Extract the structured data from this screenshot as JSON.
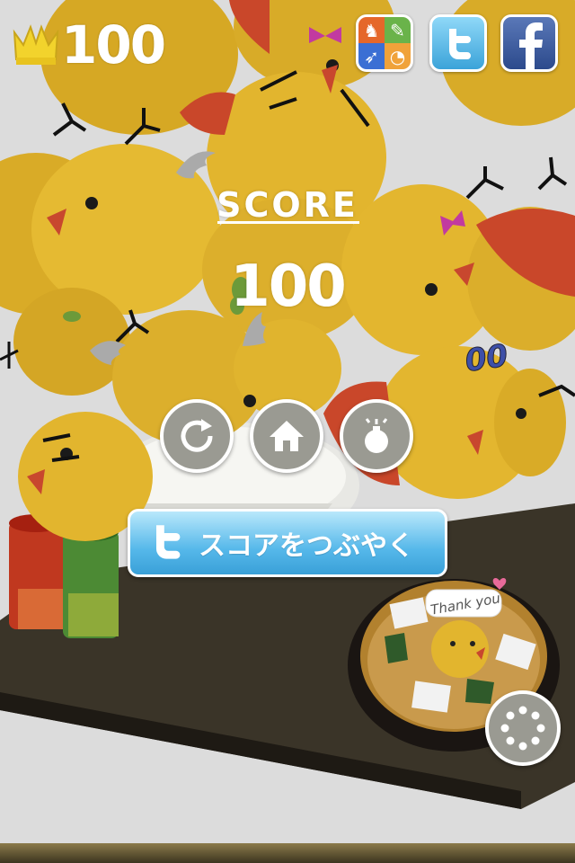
{
  "best_score": "100",
  "score": {
    "label": "SCORE",
    "value": "100"
  },
  "floating_text": "00",
  "tweet_button": {
    "label": "スコアをつぶやく"
  },
  "bowl_sign": "Thank you",
  "colors": {
    "chick": "#e2b52e",
    "twitter": "#4ab0e6",
    "facebook": "#3b5998",
    "button_gray": "#9a9a92"
  },
  "icons": [
    "crown-icon",
    "apps-icon",
    "twitter-icon",
    "facebook-icon",
    "retry-icon",
    "home-icon",
    "bomb-icon",
    "menu-icon"
  ]
}
